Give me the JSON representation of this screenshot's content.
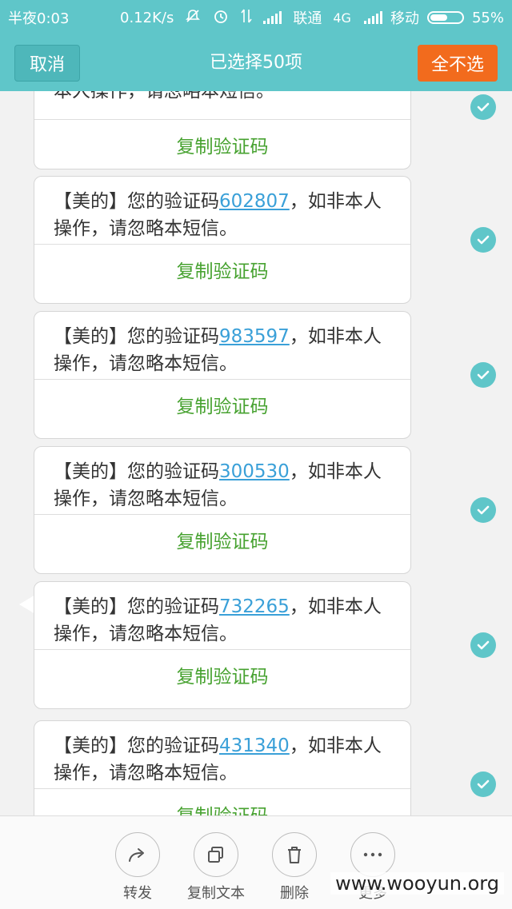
{
  "status_bar": {
    "time": "半夜0:03",
    "speed": "0.12K/s",
    "carrier1": "联通",
    "network": "4G",
    "carrier2": "移动",
    "battery": "55%",
    "battery_level": 0.55
  },
  "title_bar": {
    "cancel_label": "取消",
    "title": "已选择50项",
    "deselect_label": "全不选"
  },
  "messages": [
    {
      "prefix": "",
      "code": "",
      "suffix": "本人操作，请忽略本短信。",
      "copy": "复制验证码"
    },
    {
      "prefix": "【美的】您的验证码",
      "code": "602807",
      "suffix": "，如非本人操作，请忽略本短信。",
      "copy": "复制验证码"
    },
    {
      "prefix": "【美的】您的验证码",
      "code": "983597",
      "suffix": "，如非本人操作，请忽略本短信。",
      "copy": "复制验证码"
    },
    {
      "prefix": "【美的】您的验证码",
      "code": "300530",
      "suffix": "，如非本人操作，请忽略本短信。",
      "copy": "复制验证码"
    },
    {
      "prefix": "【美的】您的验证码",
      "code": "732265",
      "suffix": "，如非本人操作，请忽略本短信。",
      "copy": "复制验证码"
    },
    {
      "prefix": "【美的】您的验证码",
      "code": "431340",
      "suffix": "，如非本人操作，请忽略本短信。",
      "copy": "复制验证码"
    }
  ],
  "bottom_bar": {
    "actions": [
      {
        "label": "转发",
        "icon": "forward-icon"
      },
      {
        "label": "复制文本",
        "icon": "copy-icon"
      },
      {
        "label": "删除",
        "icon": "trash-icon"
      },
      {
        "label": "更多",
        "icon": "more-icon"
      }
    ]
  },
  "watermark": "www.wooyun.org",
  "colors": {
    "accent": "#5fc6c9",
    "deselect": "#f26b1d",
    "link": "#3aa0d8",
    "copy_green": "#47a230"
  }
}
